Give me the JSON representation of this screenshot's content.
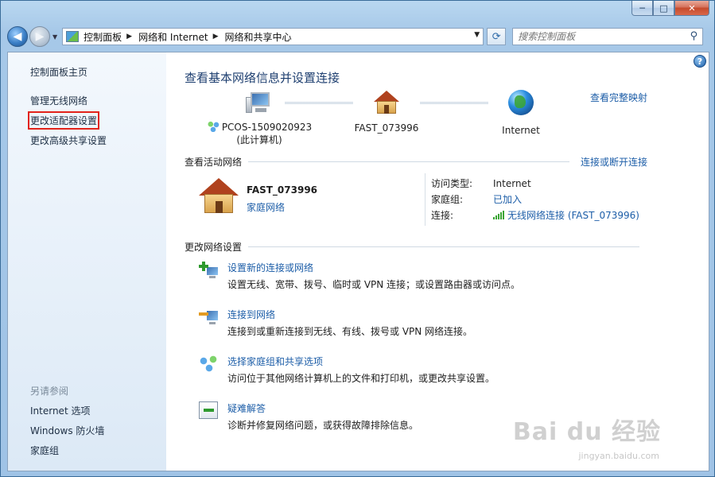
{
  "window": {
    "min_label": "─",
    "max_label": "□",
    "close_label": "✕"
  },
  "nav": {
    "back_glyph": "◀",
    "forward_glyph": "▶",
    "history_glyph": "▼",
    "breadcrumbs": [
      "控制面板",
      "网络和 Internet",
      "网络和共享中心"
    ],
    "crumb_sep": "▶",
    "address_drop": "▼",
    "refresh_glyph": "⟳",
    "search_placeholder": "搜索控制面板",
    "search_glyph": "⚲"
  },
  "sidebar": {
    "home": "控制面板主页",
    "items": [
      "管理无线网络",
      "更改适配器设置",
      "更改高级共享设置"
    ],
    "see_also_title": "另请参阅",
    "see_also": [
      "Internet 选项",
      "Windows 防火墙",
      "家庭组"
    ]
  },
  "help_glyph": "?",
  "main": {
    "title": "查看基本网络信息并设置连接",
    "full_map": "查看完整映射",
    "map": {
      "computer_name": "PCOS-1509020923",
      "computer_note": "(此计算机)",
      "network_name": "FAST_073996",
      "internet": "Internet"
    },
    "active": {
      "header": "查看活动网络",
      "connect_link": "连接或断开连接",
      "name": "FAST_073996",
      "type": "家庭网络",
      "access_type_label": "访问类型:",
      "access_type_value": "Internet",
      "homegroup_label": "家庭组:",
      "homegroup_value": "已加入",
      "connection_label": "连接:",
      "connection_value": "无线网络连接 (FAST_073996)"
    },
    "change": {
      "header": "更改网络设置",
      "tasks": [
        {
          "title": "设置新的连接或网络",
          "desc": "设置无线、宽带、拨号、临时或 VPN 连接；或设置路由器或访问点。"
        },
        {
          "title": "连接到网络",
          "desc": "连接到或重新连接到无线、有线、拨号或 VPN 网络连接。"
        },
        {
          "title": "选择家庭组和共享选项",
          "desc": "访问位于其他网络计算机上的文件和打印机，或更改共享设置。"
        },
        {
          "title": "疑难解答",
          "desc": "诊断并修复网络问题，或获得故障排除信息。"
        }
      ]
    }
  },
  "watermark": {
    "brand": "Bai du 经验",
    "url": "jingyan.baidu.com"
  }
}
